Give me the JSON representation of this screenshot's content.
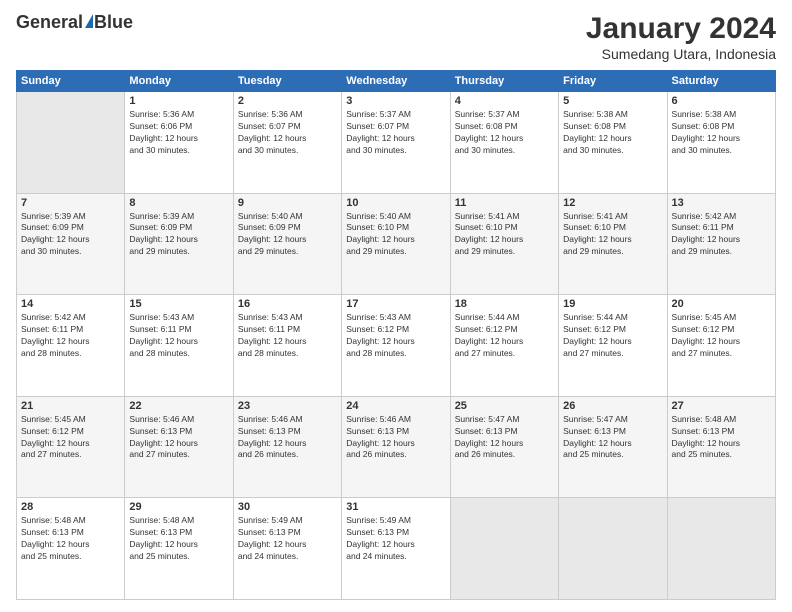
{
  "header": {
    "logo_general": "General",
    "logo_blue": "Blue",
    "month_title": "January 2024",
    "location": "Sumedang Utara, Indonesia"
  },
  "columns": [
    "Sunday",
    "Monday",
    "Tuesday",
    "Wednesday",
    "Thursday",
    "Friday",
    "Saturday"
  ],
  "weeks": [
    [
      {
        "day": "",
        "empty": true
      },
      {
        "day": "1",
        "sunrise": "5:36 AM",
        "sunset": "6:06 PM",
        "daylight": "12 hours and 30 minutes."
      },
      {
        "day": "2",
        "sunrise": "5:36 AM",
        "sunset": "6:07 PM",
        "daylight": "12 hours and 30 minutes."
      },
      {
        "day": "3",
        "sunrise": "5:37 AM",
        "sunset": "6:07 PM",
        "daylight": "12 hours and 30 minutes."
      },
      {
        "day": "4",
        "sunrise": "5:37 AM",
        "sunset": "6:08 PM",
        "daylight": "12 hours and 30 minutes."
      },
      {
        "day": "5",
        "sunrise": "5:38 AM",
        "sunset": "6:08 PM",
        "daylight": "12 hours and 30 minutes."
      },
      {
        "day": "6",
        "sunrise": "5:38 AM",
        "sunset": "6:08 PM",
        "daylight": "12 hours and 30 minutes."
      }
    ],
    [
      {
        "day": "7",
        "sunrise": "5:39 AM",
        "sunset": "6:09 PM",
        "daylight": "12 hours and 30 minutes."
      },
      {
        "day": "8",
        "sunrise": "5:39 AM",
        "sunset": "6:09 PM",
        "daylight": "12 hours and 29 minutes."
      },
      {
        "day": "9",
        "sunrise": "5:40 AM",
        "sunset": "6:09 PM",
        "daylight": "12 hours and 29 minutes."
      },
      {
        "day": "10",
        "sunrise": "5:40 AM",
        "sunset": "6:10 PM",
        "daylight": "12 hours and 29 minutes."
      },
      {
        "day": "11",
        "sunrise": "5:41 AM",
        "sunset": "6:10 PM",
        "daylight": "12 hours and 29 minutes."
      },
      {
        "day": "12",
        "sunrise": "5:41 AM",
        "sunset": "6:10 PM",
        "daylight": "12 hours and 29 minutes."
      },
      {
        "day": "13",
        "sunrise": "5:42 AM",
        "sunset": "6:11 PM",
        "daylight": "12 hours and 29 minutes."
      }
    ],
    [
      {
        "day": "14",
        "sunrise": "5:42 AM",
        "sunset": "6:11 PM",
        "daylight": "12 hours and 28 minutes."
      },
      {
        "day": "15",
        "sunrise": "5:43 AM",
        "sunset": "6:11 PM",
        "daylight": "12 hours and 28 minutes."
      },
      {
        "day": "16",
        "sunrise": "5:43 AM",
        "sunset": "6:11 PM",
        "daylight": "12 hours and 28 minutes."
      },
      {
        "day": "17",
        "sunrise": "5:43 AM",
        "sunset": "6:12 PM",
        "daylight": "12 hours and 28 minutes."
      },
      {
        "day": "18",
        "sunrise": "5:44 AM",
        "sunset": "6:12 PM",
        "daylight": "12 hours and 27 minutes."
      },
      {
        "day": "19",
        "sunrise": "5:44 AM",
        "sunset": "6:12 PM",
        "daylight": "12 hours and 27 minutes."
      },
      {
        "day": "20",
        "sunrise": "5:45 AM",
        "sunset": "6:12 PM",
        "daylight": "12 hours and 27 minutes."
      }
    ],
    [
      {
        "day": "21",
        "sunrise": "5:45 AM",
        "sunset": "6:12 PM",
        "daylight": "12 hours and 27 minutes."
      },
      {
        "day": "22",
        "sunrise": "5:46 AM",
        "sunset": "6:13 PM",
        "daylight": "12 hours and 27 minutes."
      },
      {
        "day": "23",
        "sunrise": "5:46 AM",
        "sunset": "6:13 PM",
        "daylight": "12 hours and 26 minutes."
      },
      {
        "day": "24",
        "sunrise": "5:46 AM",
        "sunset": "6:13 PM",
        "daylight": "12 hours and 26 minutes."
      },
      {
        "day": "25",
        "sunrise": "5:47 AM",
        "sunset": "6:13 PM",
        "daylight": "12 hours and 26 minutes."
      },
      {
        "day": "26",
        "sunrise": "5:47 AM",
        "sunset": "6:13 PM",
        "daylight": "12 hours and 25 minutes."
      },
      {
        "day": "27",
        "sunrise": "5:48 AM",
        "sunset": "6:13 PM",
        "daylight": "12 hours and 25 minutes."
      }
    ],
    [
      {
        "day": "28",
        "sunrise": "5:48 AM",
        "sunset": "6:13 PM",
        "daylight": "12 hours and 25 minutes."
      },
      {
        "day": "29",
        "sunrise": "5:48 AM",
        "sunset": "6:13 PM",
        "daylight": "12 hours and 25 minutes."
      },
      {
        "day": "30",
        "sunrise": "5:49 AM",
        "sunset": "6:13 PM",
        "daylight": "12 hours and 24 minutes."
      },
      {
        "day": "31",
        "sunrise": "5:49 AM",
        "sunset": "6:13 PM",
        "daylight": "12 hours and 24 minutes."
      },
      {
        "day": "",
        "empty": true
      },
      {
        "day": "",
        "empty": true
      },
      {
        "day": "",
        "empty": true
      }
    ]
  ],
  "labels": {
    "sunrise": "Sunrise:",
    "sunset": "Sunset:",
    "daylight": "Daylight:"
  }
}
